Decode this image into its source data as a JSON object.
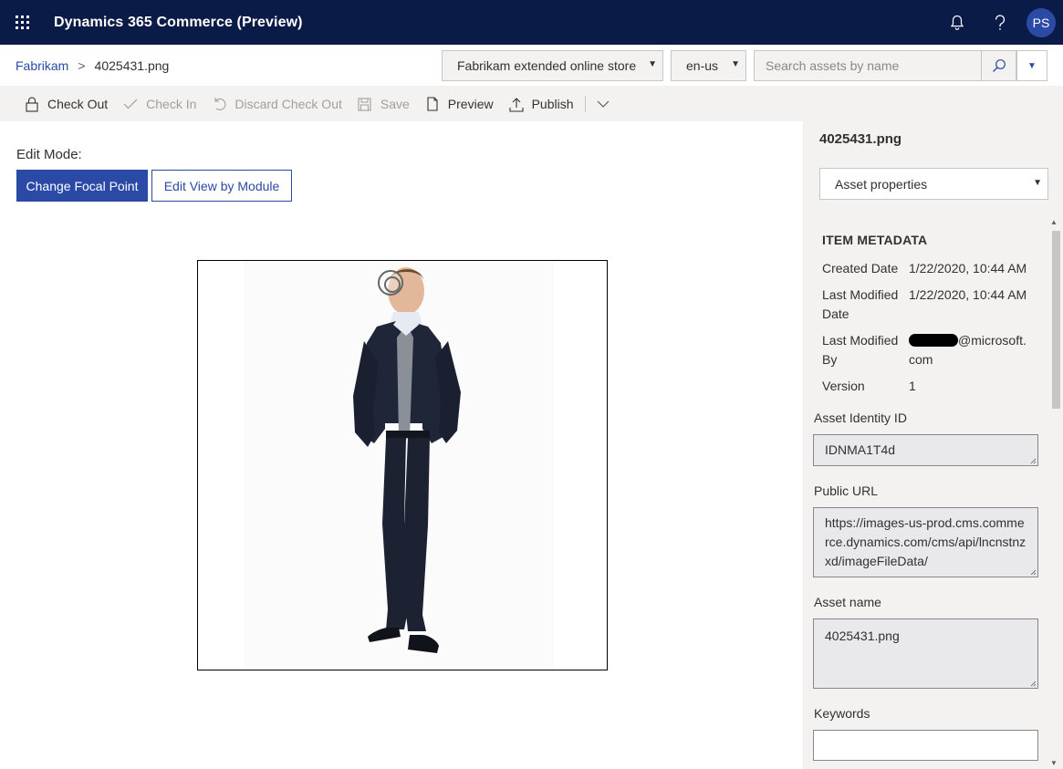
{
  "topbar": {
    "title": "Dynamics 365 Commerce (Preview)",
    "user_initials": "PS",
    "icons": [
      "waffle-icon",
      "bell-icon",
      "help-icon"
    ]
  },
  "breadcrumb": {
    "root": "Fabrikam",
    "separator": ">",
    "current": "4025431.png"
  },
  "filters": {
    "store": "Fabrikam extended online store",
    "locale": "en-us",
    "search_placeholder": "Search assets by name"
  },
  "commands": {
    "check_out": "Check Out",
    "check_in": "Check In",
    "discard_check_out": "Discard Check Out",
    "save": "Save",
    "preview": "Preview",
    "publish": "Publish"
  },
  "editor": {
    "mode_label": "Edit Mode:",
    "change_focal_point": "Change Focal Point",
    "edit_view_by_module": "Edit View by Module"
  },
  "panel": {
    "title": "4025431.png",
    "view_select": "Asset properties",
    "metadata_heading": "ITEM METADATA",
    "created_date_label": "Created Date",
    "created_date_value": "1/22/2020, 10:44 AM",
    "last_modified_date_label": "Last Modified Date",
    "last_modified_date_value": "1/22/2020, 10:44 AM",
    "last_modified_by_label": "Last Modified By",
    "last_modified_by_value": "@microsoft.com",
    "version_label": "Version",
    "version_value": "1",
    "asset_identity_label": "Asset Identity ID",
    "asset_identity_value": "IDNMA1T4d",
    "public_url_label": "Public URL",
    "public_url_value": "https://images-us-prod.cms.commerce.dynamics.com/cms/api/lncnstnzxd/imageFileData/",
    "asset_name_label": "Asset name",
    "asset_name_value": "4025431.png",
    "keywords_label": "Keywords",
    "keywords_value": ""
  },
  "colors": {
    "topbar": "#0b1b47",
    "accent": "#2b4aa5",
    "panel_bg": "#f3f2f1",
    "readonly_field": "#e9e9ec"
  }
}
